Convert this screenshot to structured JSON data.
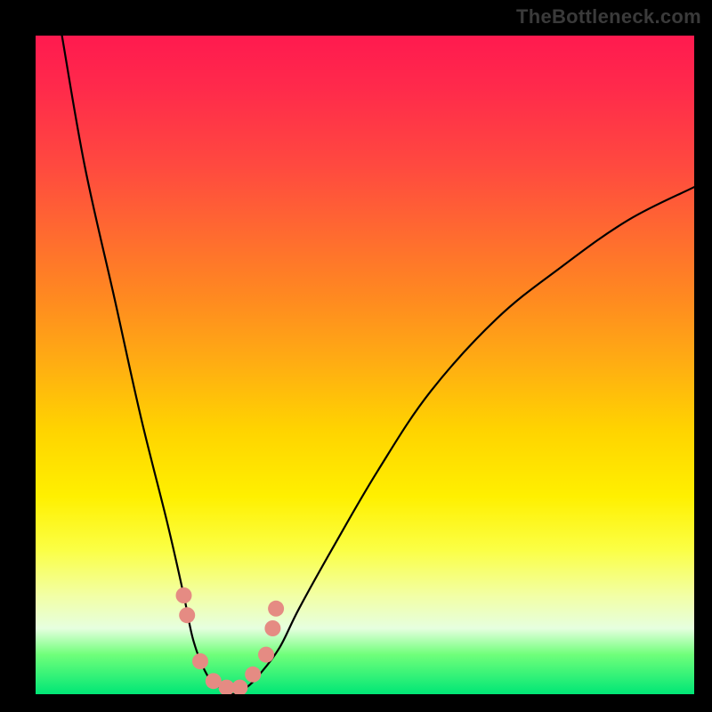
{
  "watermark": "TheBottleneck.com",
  "chart_data": {
    "type": "line",
    "title": "",
    "xlabel": "",
    "ylabel": "",
    "xlim": [
      0,
      100
    ],
    "ylim": [
      0,
      100
    ],
    "grid": false,
    "legend": false,
    "series": [
      {
        "name": "bottleneck-curve",
        "x": [
          4,
          7.5,
          12,
          16,
          20,
          22.5,
          24,
          26,
          28,
          30,
          32,
          34,
          37,
          40,
          45,
          52,
          60,
          70,
          80,
          90,
          100
        ],
        "y": [
          100,
          80,
          60,
          42,
          26,
          15,
          8,
          3,
          1,
          0,
          1,
          3,
          7,
          13,
          22,
          34,
          46,
          57,
          65,
          72,
          77
        ]
      }
    ],
    "markers": [
      {
        "x": 22.5,
        "y": 15
      },
      {
        "x": 23,
        "y": 12
      },
      {
        "x": 25,
        "y": 5
      },
      {
        "x": 27,
        "y": 2
      },
      {
        "x": 29,
        "y": 1
      },
      {
        "x": 31,
        "y": 1
      },
      {
        "x": 33,
        "y": 3
      },
      {
        "x": 35,
        "y": 6
      },
      {
        "x": 36,
        "y": 10
      },
      {
        "x": 36.5,
        "y": 13
      }
    ],
    "gradient_stops": [
      {
        "pos": 0,
        "color": "#ff1a4f"
      },
      {
        "pos": 50,
        "color": "#ffd400"
      },
      {
        "pos": 100,
        "color": "#00e676"
      }
    ]
  }
}
